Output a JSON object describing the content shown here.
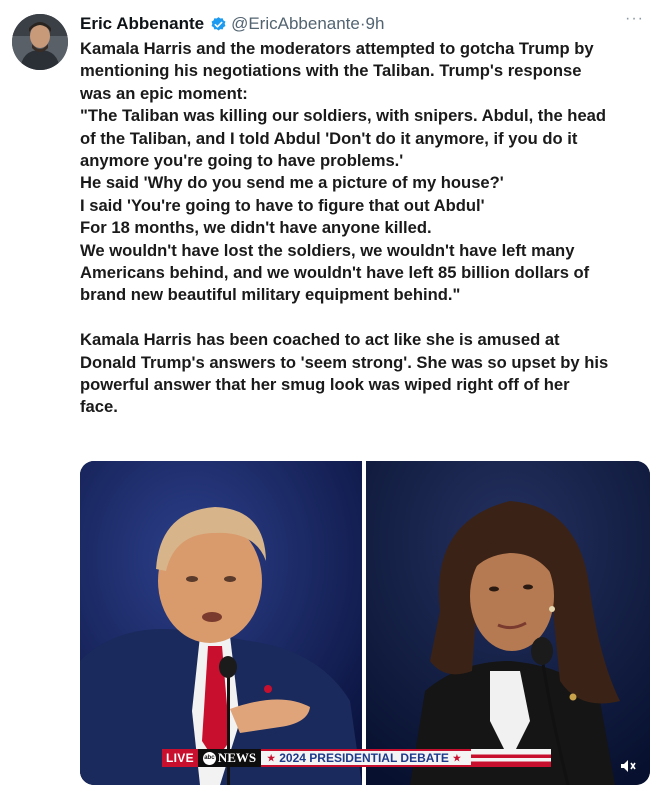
{
  "tweet": {
    "author": {
      "display_name": "Eric Abbenante",
      "handle": "@EricAbbenante",
      "separator": "·",
      "time": "9h",
      "verified": true,
      "avatar_icon": "profile-photo"
    },
    "more_icon": "more-horizontal-icon",
    "text_lines": [
      "Kamala Harris and the moderators attempted to gotcha Trump by",
      "mentioning his negotiations with the Taliban. Trump's response",
      "was an epic moment:",
      "\"The Taliban was killing our soldiers, with snipers. Abdul, the head",
      "of the Taliban, and I told Abdul 'Don't do it anymore, if you do it",
      "anymore you're going to have problems.'",
      "He said 'Why do you send me a picture of my house?'",
      "I said 'You're going to have to figure that out Abdul'",
      "For 18 months, we didn't have anyone killed.",
      "We wouldn't have lost the soldiers, we wouldn't have left many",
      "Americans behind, and we wouldn't have left 85 billion dollars of",
      "brand new beautiful military equipment behind.\""
    ],
    "text_lines_2": [
      "Kamala Harris has been coached to act like she is amused at",
      "Donald Trump's answers to 'seem strong'. She was so upset by his",
      "powerful answer that her smug look was wiped right off of her",
      "face."
    ]
  },
  "media": {
    "ticker": {
      "live": "LIVE",
      "network": "NEWS",
      "banner": "2024 PRESIDENTIAL DEBATE"
    },
    "volume_icon": "volume-muted-icon"
  },
  "colors": {
    "verified": "#1d9bf0",
    "text": "#0f1419",
    "secondary": "#536471",
    "ticker_red": "#c8102e",
    "ticker_blue": "#1e3a8a"
  }
}
